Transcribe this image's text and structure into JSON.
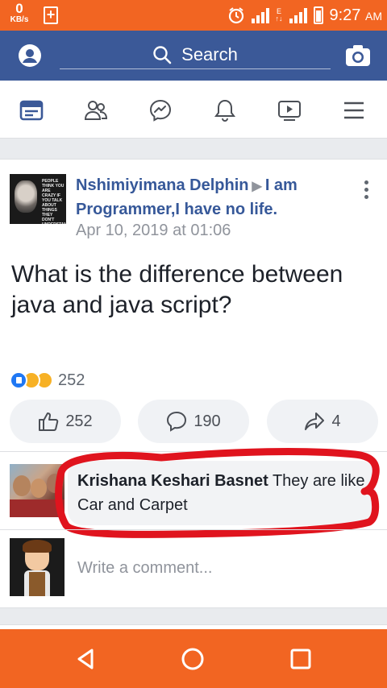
{
  "status_bar": {
    "net_speed": "0",
    "net_unit": "KB/s",
    "network_label": "E",
    "time": "9:27",
    "ampm": "AM",
    "color": "#f26522"
  },
  "header": {
    "search_label": "Search",
    "color": "#3b5998",
    "icons": [
      "profile-icon",
      "search-icon",
      "camera-icon"
    ]
  },
  "nav": {
    "icons": [
      "news-feed-icon",
      "friends-icon",
      "messenger-icon",
      "notifications-icon",
      "watch-icon",
      "menu-icon"
    ],
    "active_color": "#3b5998"
  },
  "post": {
    "author": "Nshimiyimana Delphin",
    "group": "I am Programmer,I have no life.",
    "date": "Apr 10, 2019 at 01:06",
    "text": "What is the difference between java and java script?",
    "reaction_count": "252",
    "reactions": [
      "like",
      "haha",
      "sad"
    ],
    "actions": {
      "likes": "252",
      "comments": "190",
      "shares": "4"
    },
    "avatar_text": "PEOPLE THINK YOU ARE CRAZY IF YOU TALK ABOUT THINGS THEY DON'T UNDERSTAND"
  },
  "comment": {
    "author": "Krishana Keshari Basnet",
    "text": "They are like Car and Carpet",
    "highlight_color": "#e0141e"
  },
  "composer": {
    "placeholder": "Write a comment..."
  },
  "android_nav": {
    "icons": [
      "back-icon",
      "home-icon",
      "recents-icon"
    ]
  }
}
